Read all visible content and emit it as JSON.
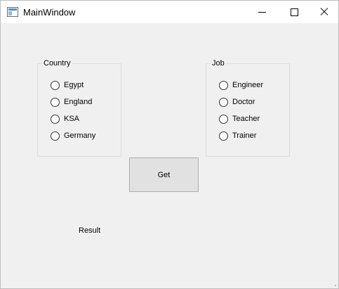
{
  "window": {
    "title": "MainWindow",
    "icon": "window-app-icon",
    "controls": [
      "minimize-icon",
      "maximize-icon",
      "close-icon"
    ]
  },
  "country_group": {
    "title": "Country",
    "options": [
      {
        "label": "Egypt",
        "checked": false
      },
      {
        "label": "England",
        "checked": false
      },
      {
        "label": "KSA",
        "checked": false
      },
      {
        "label": "Germany",
        "checked": false
      }
    ]
  },
  "job_group": {
    "title": "Job",
    "options": [
      {
        "label": "Engineer",
        "checked": false
      },
      {
        "label": "Doctor",
        "checked": false
      },
      {
        "label": "Teacher",
        "checked": false
      },
      {
        "label": "Trainer",
        "checked": false
      }
    ]
  },
  "get_button": {
    "label": "Get"
  },
  "result": {
    "text": "Result"
  },
  "colors": {
    "window_bg": "#f0f0f0",
    "titlebar_bg": "#ffffff",
    "button_bg": "#e1e1e1",
    "group_border": "#dcdcdc"
  }
}
